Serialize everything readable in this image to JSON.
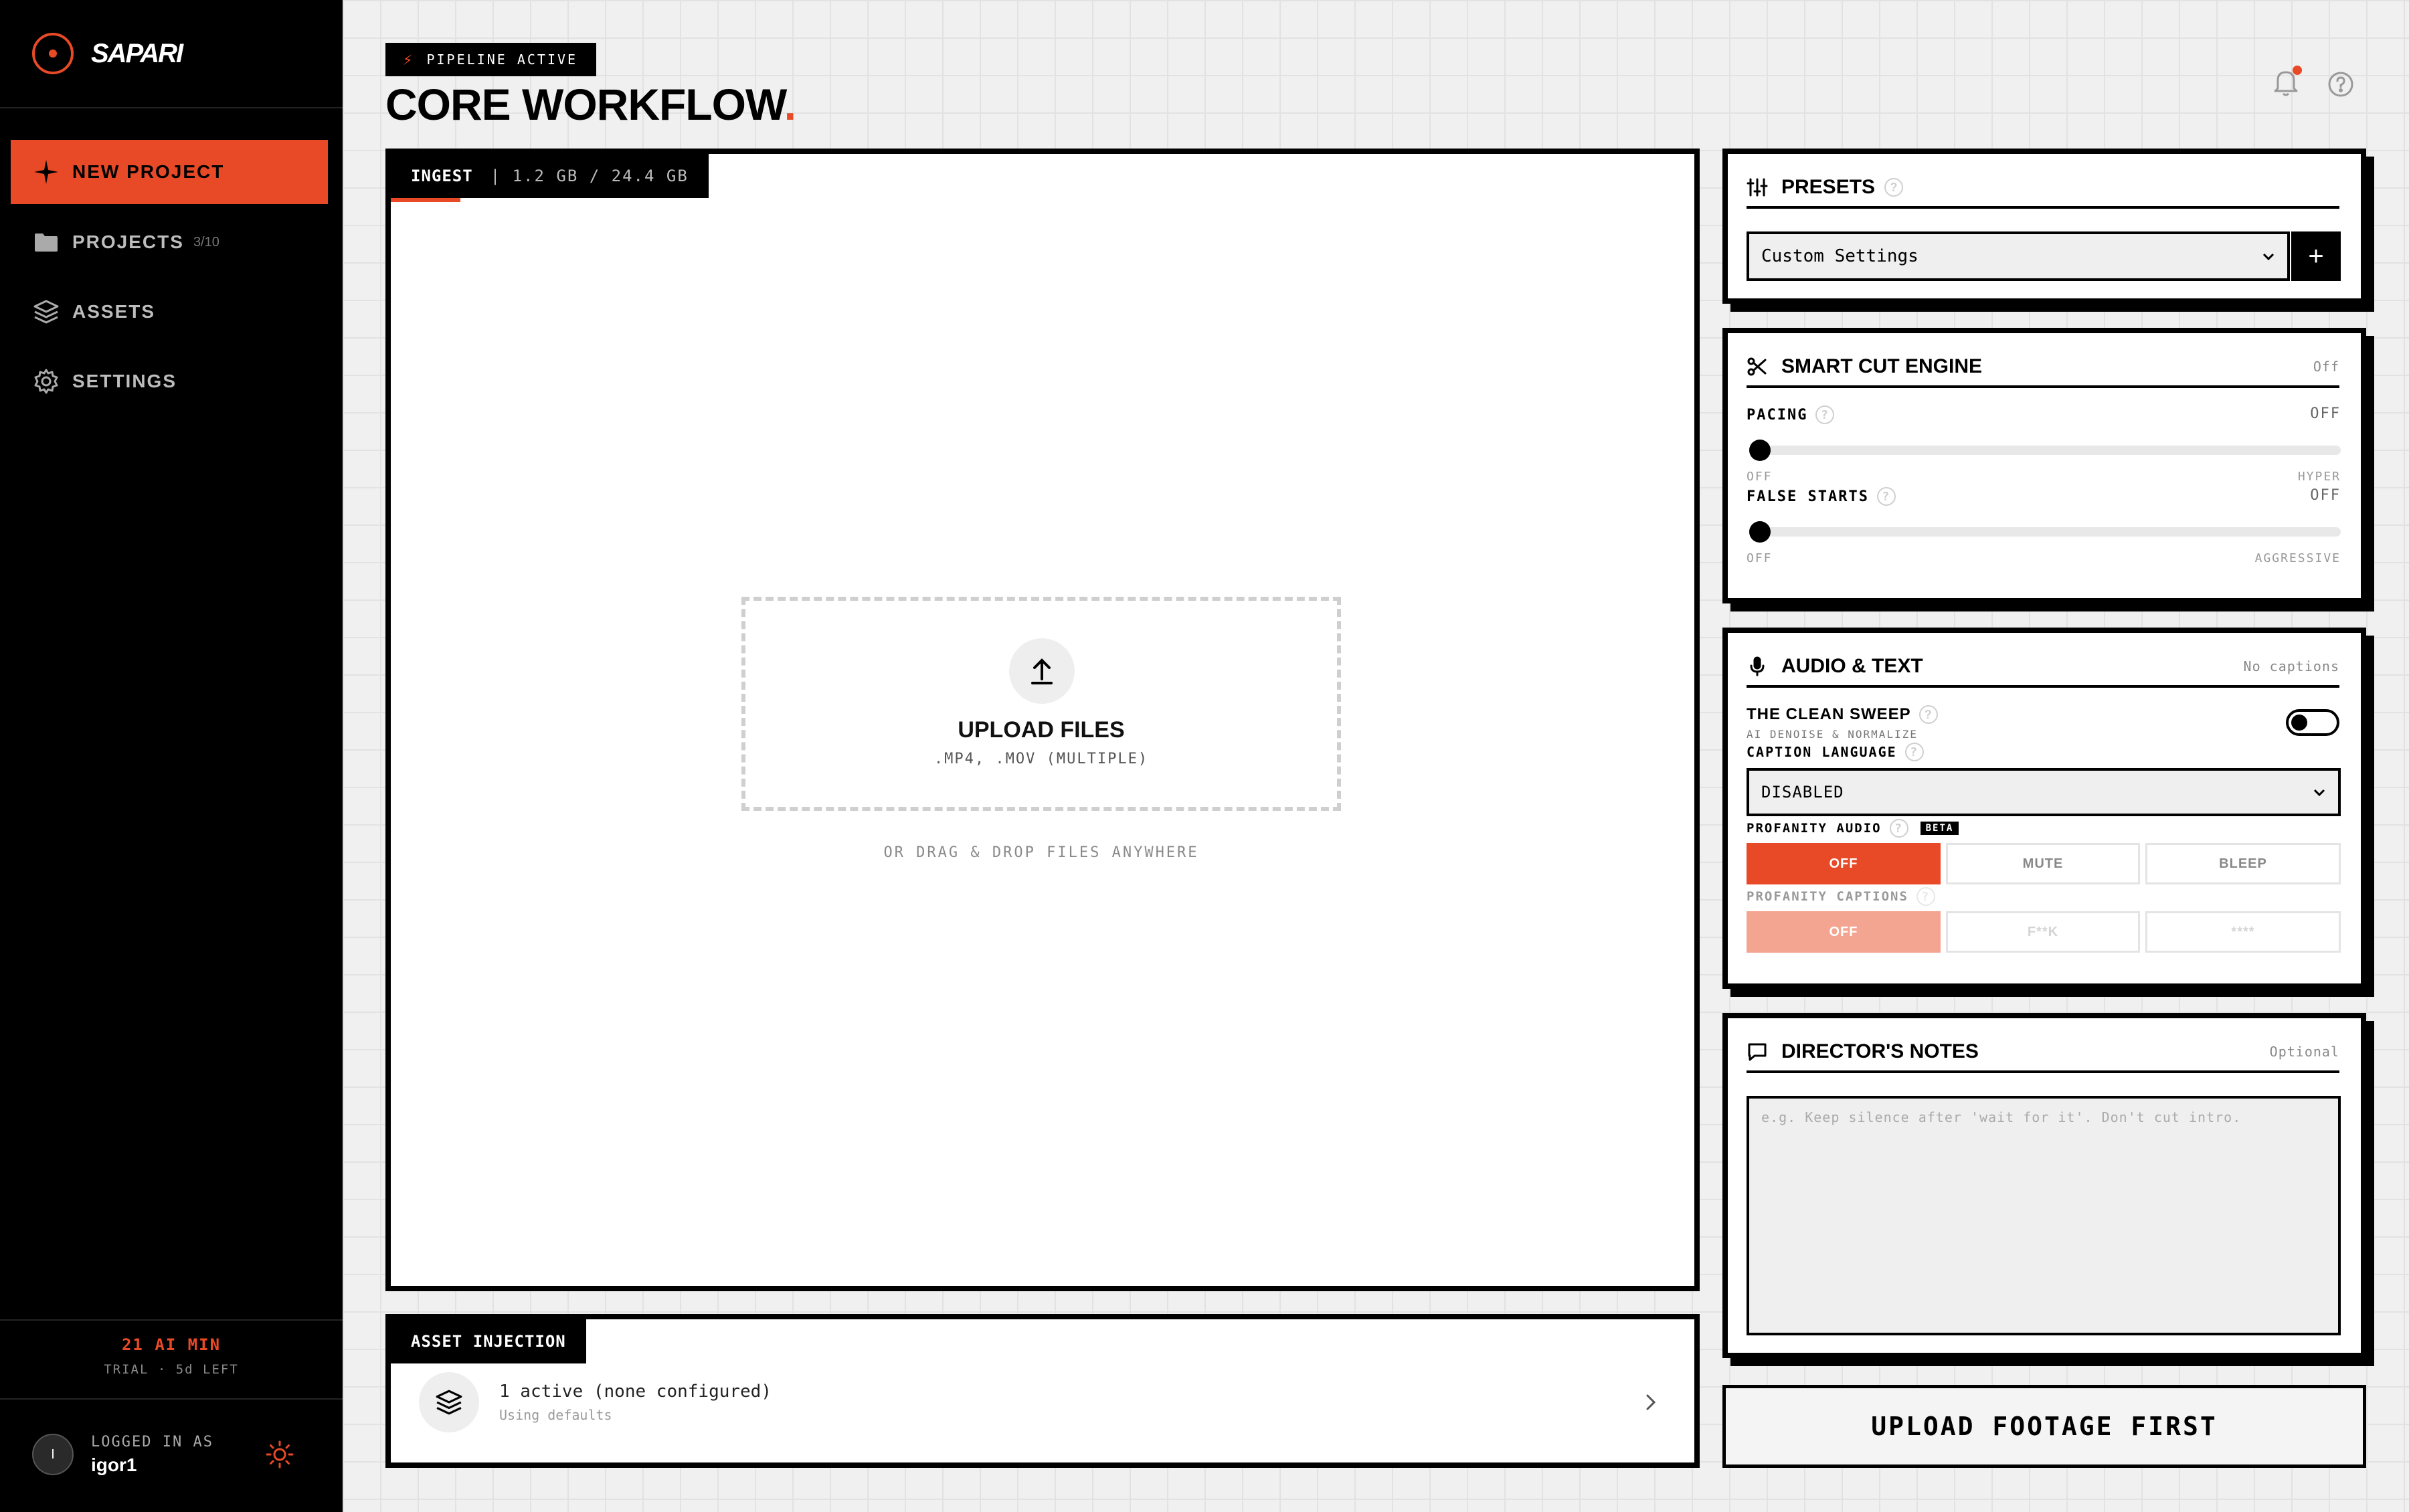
{
  "brand": {
    "name": "SAPARI",
    "accent": "#e84a27"
  },
  "sidebar": {
    "items": [
      {
        "label": "NEW PROJECT",
        "icon": "sparkle-icon",
        "badge": ""
      },
      {
        "label": "PROJECTS",
        "icon": "folder-icon",
        "badge": "3/10"
      },
      {
        "label": "ASSETS",
        "icon": "layers-icon",
        "badge": ""
      },
      {
        "label": "SETTINGS",
        "icon": "gear-icon",
        "badge": ""
      }
    ],
    "credits": {
      "minutes": "21 AI MIN",
      "trial": "TRIAL · 5d LEFT"
    },
    "user": {
      "initial": "I",
      "label": "LOGGED IN AS",
      "name": "igor1"
    }
  },
  "header": {
    "status": "PIPELINE ACTIVE",
    "title": "CORE WORKFLOW",
    "title_dot": "."
  },
  "ingest": {
    "tab": "INGEST",
    "storage": "| 1.2 GB / 24.4 GB",
    "upload_title": "UPLOAD FILES",
    "upload_formats": ".MP4, .MOV (MULTIPLE)",
    "drag_hint": "OR DRAG & DROP FILES ANYWHERE"
  },
  "asset_injection": {
    "tab": "ASSET INJECTION",
    "line1": "1 active (none configured)",
    "line2": "Using defaults"
  },
  "presets": {
    "title": "PRESETS",
    "selected": "Custom Settings",
    "add_label": "+"
  },
  "smart_cut": {
    "title": "SMART CUT ENGINE",
    "status": "Off",
    "pacing": {
      "label": "PACING",
      "value": "OFF",
      "min": "OFF",
      "max": "HYPER",
      "level": 0
    },
    "false_starts": {
      "label": "FALSE STARTS",
      "value": "OFF",
      "min": "OFF",
      "max": "AGGRESSIVE",
      "level": 0
    }
  },
  "audio_text": {
    "title": "AUDIO & TEXT",
    "status": "No captions",
    "clean_sweep": {
      "label": "THE CLEAN SWEEP",
      "sub": "AI DENOISE & NORMALIZE",
      "enabled": false
    },
    "caption_language": {
      "label": "CAPTION LANGUAGE",
      "value": "DISABLED"
    },
    "profanity_audio": {
      "label": "PROFANITY AUDIO",
      "badge": "BETA",
      "options": [
        "OFF",
        "MUTE",
        "BLEEP"
      ],
      "selected": "OFF"
    },
    "profanity_captions": {
      "label": "PROFANITY CAPTIONS",
      "options": [
        "OFF",
        "F**K",
        "****"
      ],
      "selected": "OFF"
    }
  },
  "notes": {
    "title": "DIRECTOR'S NOTES",
    "status": "Optional",
    "placeholder": "e.g. Keep silence after 'wait for it'. Don't cut intro."
  },
  "cta": {
    "label": "UPLOAD FOOTAGE FIRST"
  }
}
